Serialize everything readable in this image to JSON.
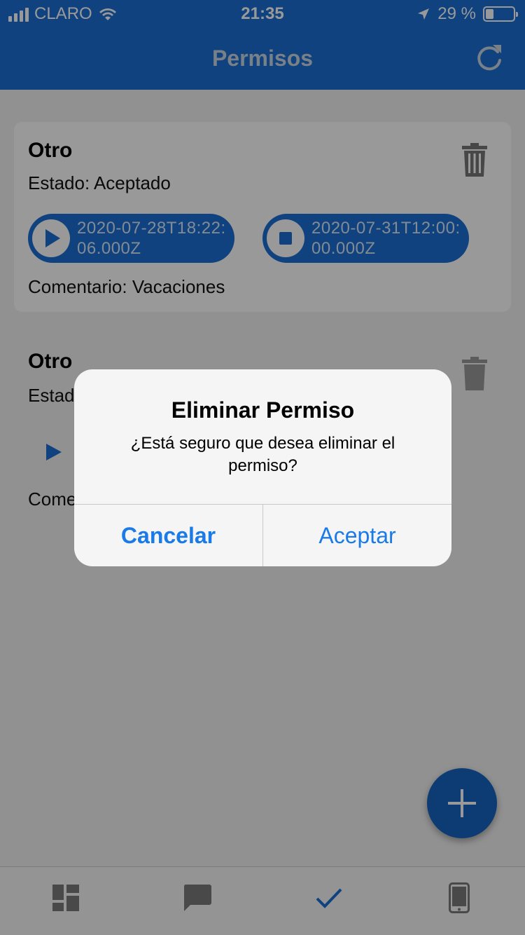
{
  "status_bar": {
    "carrier": "CLARO",
    "time": "21:35",
    "battery": "29 %"
  },
  "nav": {
    "title": "Permisos",
    "refresh_icon": "refresh-icon"
  },
  "permits": [
    {
      "title": "Otro",
      "estado": "Estado: Aceptado",
      "start": "2020-07-28T18:22:06.000Z",
      "end": "2020-07-31T12:00:00.000Z",
      "comentario": "Comentario: Vacaciones"
    },
    {
      "title": "Otro",
      "estado_partial": "Estad",
      "comentario_partial": "Come"
    }
  ],
  "alert": {
    "title": "Eliminar Permiso",
    "message": "¿Está seguro que desea eliminar el permiso?",
    "cancel": "Cancelar",
    "accept": "Aceptar"
  },
  "tabs": [
    {
      "icon": "dashboard-icon"
    },
    {
      "icon": "chat-icon"
    },
    {
      "icon": "check-icon",
      "active": true
    },
    {
      "icon": "phone-icon"
    }
  ],
  "colors": {
    "primary": "#1a6fd2",
    "link": "#1a7ae8"
  }
}
